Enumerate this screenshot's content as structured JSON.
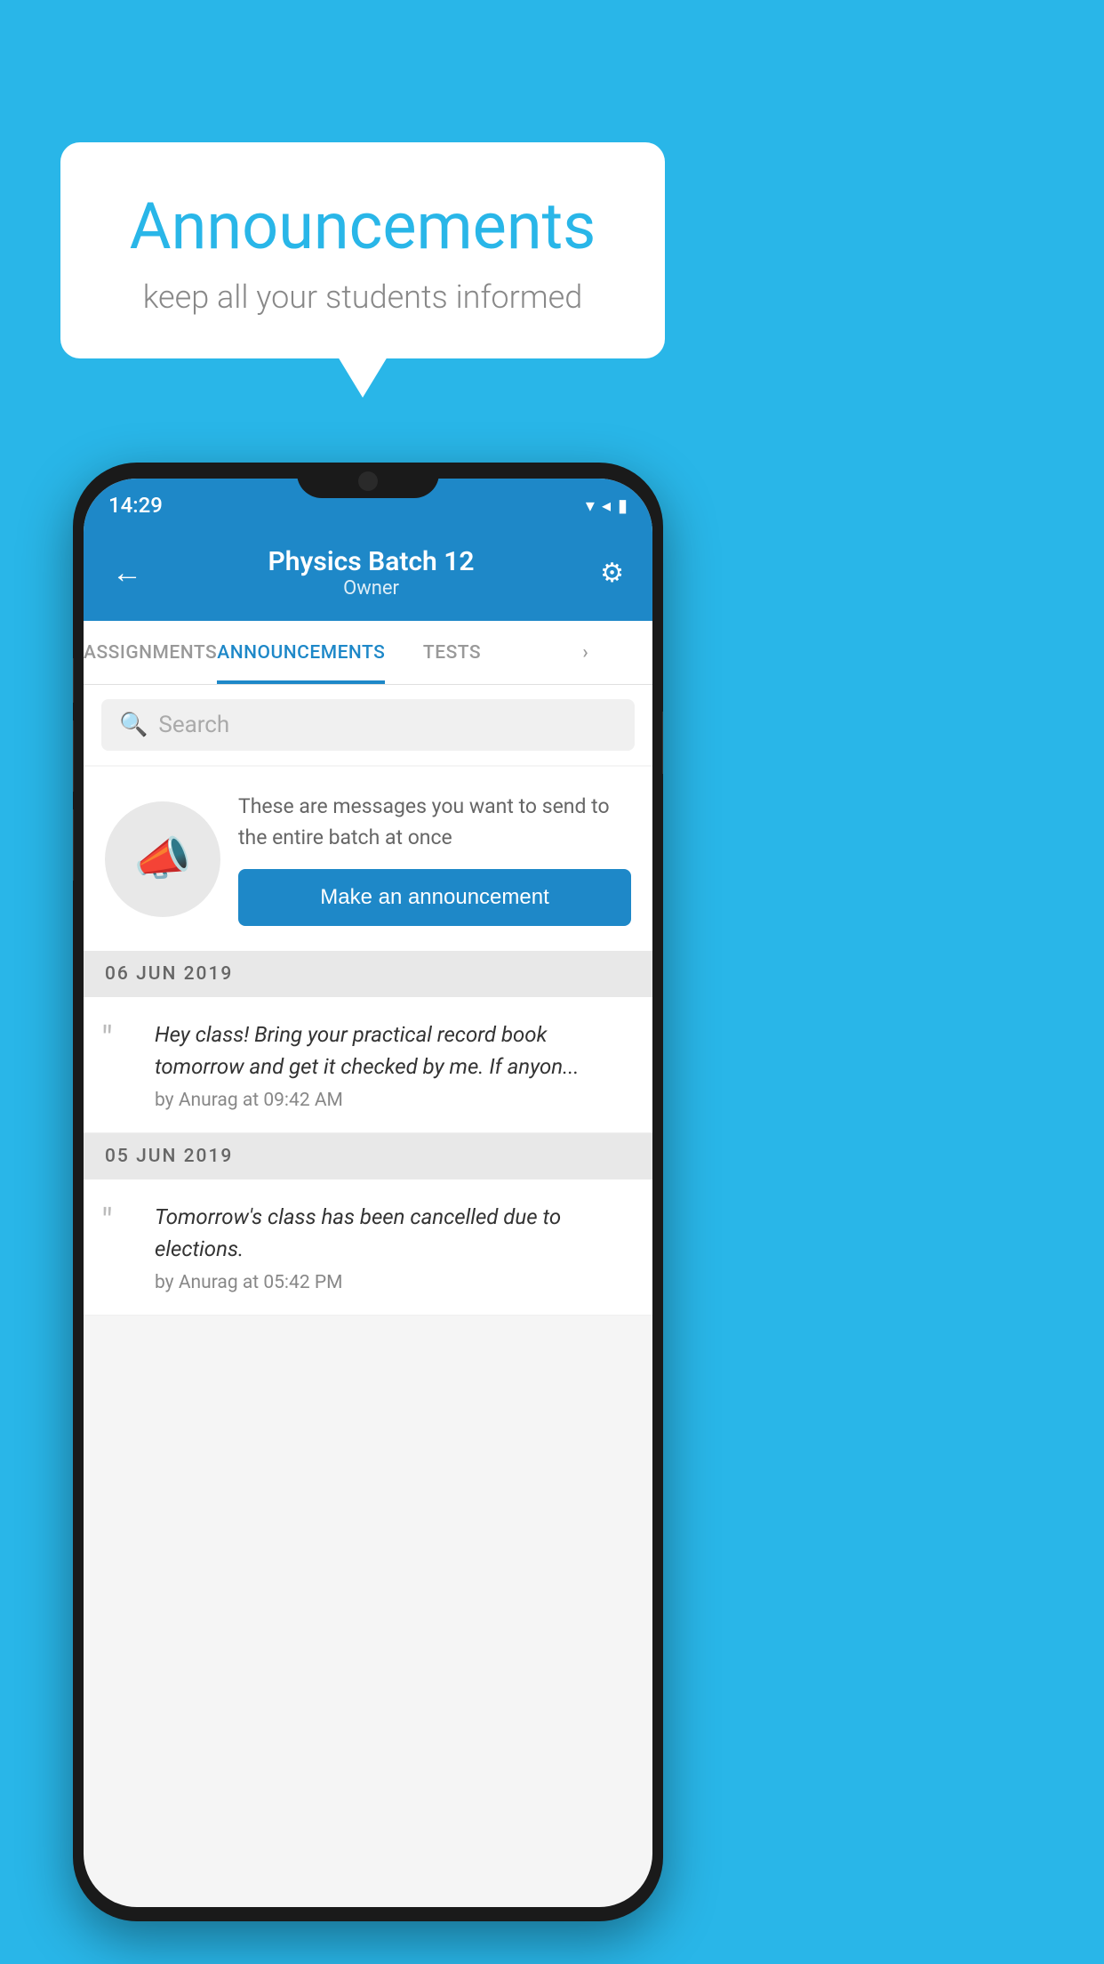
{
  "background_color": "#29b6e8",
  "bubble": {
    "title": "Announcements",
    "subtitle": "keep all your students informed"
  },
  "phone": {
    "status_bar": {
      "time": "14:29",
      "icons": "▾◂▮"
    },
    "header": {
      "title": "Physics Batch 12",
      "subtitle": "Owner",
      "back_label": "←",
      "settings_label": "⚙"
    },
    "tabs": [
      {
        "label": "ASSIGNMENTS",
        "active": false
      },
      {
        "label": "ANNOUNCEMENTS",
        "active": true
      },
      {
        "label": "TESTS",
        "active": false
      },
      {
        "label": "…",
        "active": false
      }
    ],
    "search": {
      "placeholder": "Search"
    },
    "promo": {
      "description": "These are messages you want to send to the entire batch at once",
      "button_label": "Make an announcement"
    },
    "announcements": [
      {
        "date": "06  JUN  2019",
        "text": "Hey class! Bring your practical record book tomorrow and get it checked by me. If anyon...",
        "meta": "by Anurag at 09:42 AM"
      },
      {
        "date": "05  JUN  2019",
        "text": "Tomorrow's class has been cancelled due to elections.",
        "meta": "by Anurag at 05:42 PM"
      }
    ]
  }
}
